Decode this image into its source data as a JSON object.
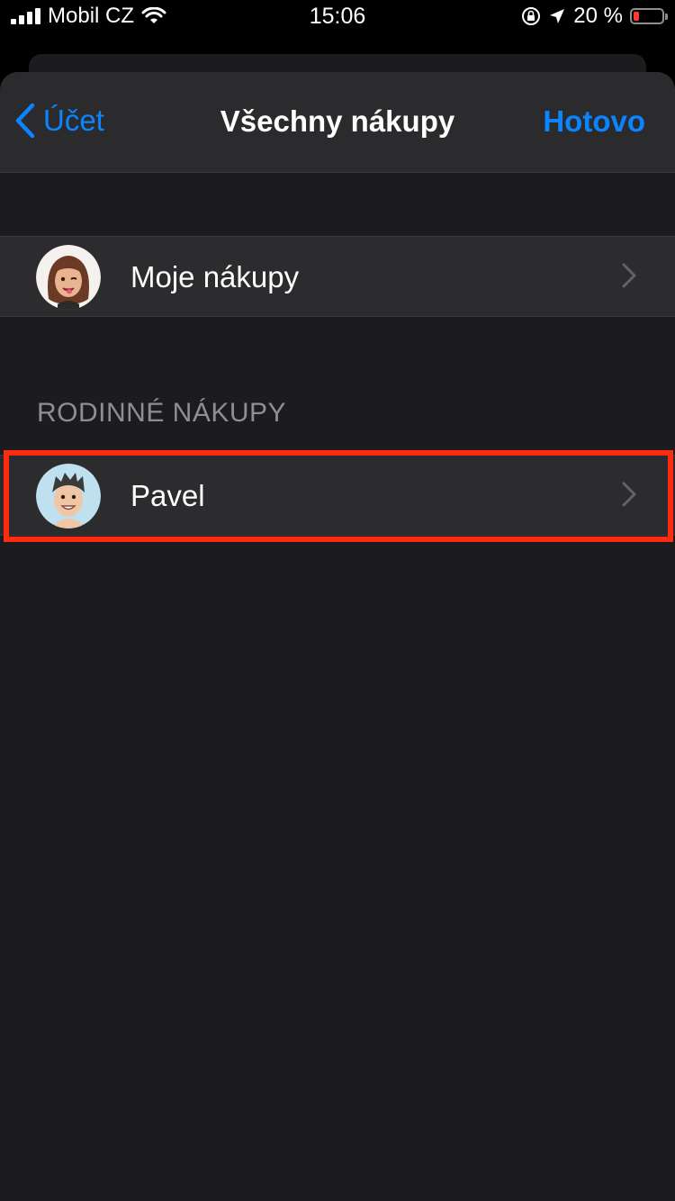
{
  "status_bar": {
    "carrier": "Mobil CZ",
    "time": "15:06",
    "battery_percent": "20 %",
    "battery_level": 0.2,
    "icons": [
      "signal-icon",
      "wifi-icon",
      "orientation-lock-icon",
      "location-icon",
      "battery-icon"
    ]
  },
  "nav": {
    "back_label": "Účet",
    "title": "Všechny nákupy",
    "done_label": "Hotovo"
  },
  "my_purchases": {
    "label": "Moje nákupy"
  },
  "family": {
    "header": "RODINNÉ NÁKUPY",
    "members": [
      {
        "label": "Pavel",
        "highlighted": true
      }
    ]
  },
  "colors": {
    "accent": "#0a84ff",
    "highlight": "#ff2a12",
    "battery_low": "#ff3b30"
  }
}
